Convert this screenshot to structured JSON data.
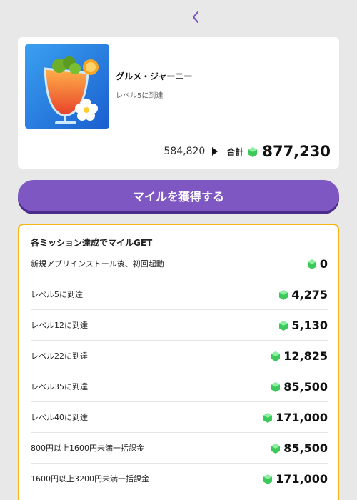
{
  "app": {
    "name": "グルメ・ジャーニー",
    "subtitle": "レベル5に到達",
    "icon": "tropical-drink-app-icon"
  },
  "summary": {
    "original_value": "584,820",
    "total_label": "合計",
    "total_value": "877,230"
  },
  "cta": {
    "label": "マイルを獲得する"
  },
  "missions": {
    "title": "各ミッション達成でマイルGET",
    "items": [
      {
        "label": "新規アプリインストール後、初回起動",
        "value": "0"
      },
      {
        "label": "レベル5に到達",
        "value": "4,275"
      },
      {
        "label": "レベル12に到達",
        "value": "5,130"
      },
      {
        "label": "レベル22に到達",
        "value": "12,825"
      },
      {
        "label": "レベル35に到達",
        "value": "85,500"
      },
      {
        "label": "レベル40に到達",
        "value": "171,000"
      },
      {
        "label": "800円以上1600円未満一括課金",
        "value": "85,500"
      },
      {
        "label": "1600円以上3200円未満一括課金",
        "value": "171,000"
      }
    ]
  },
  "colors": {
    "accent": "#7e57c2",
    "accent_shadow": "#4b2c8c",
    "mission_border": "#f5b614",
    "gem": "#3cc85a"
  }
}
